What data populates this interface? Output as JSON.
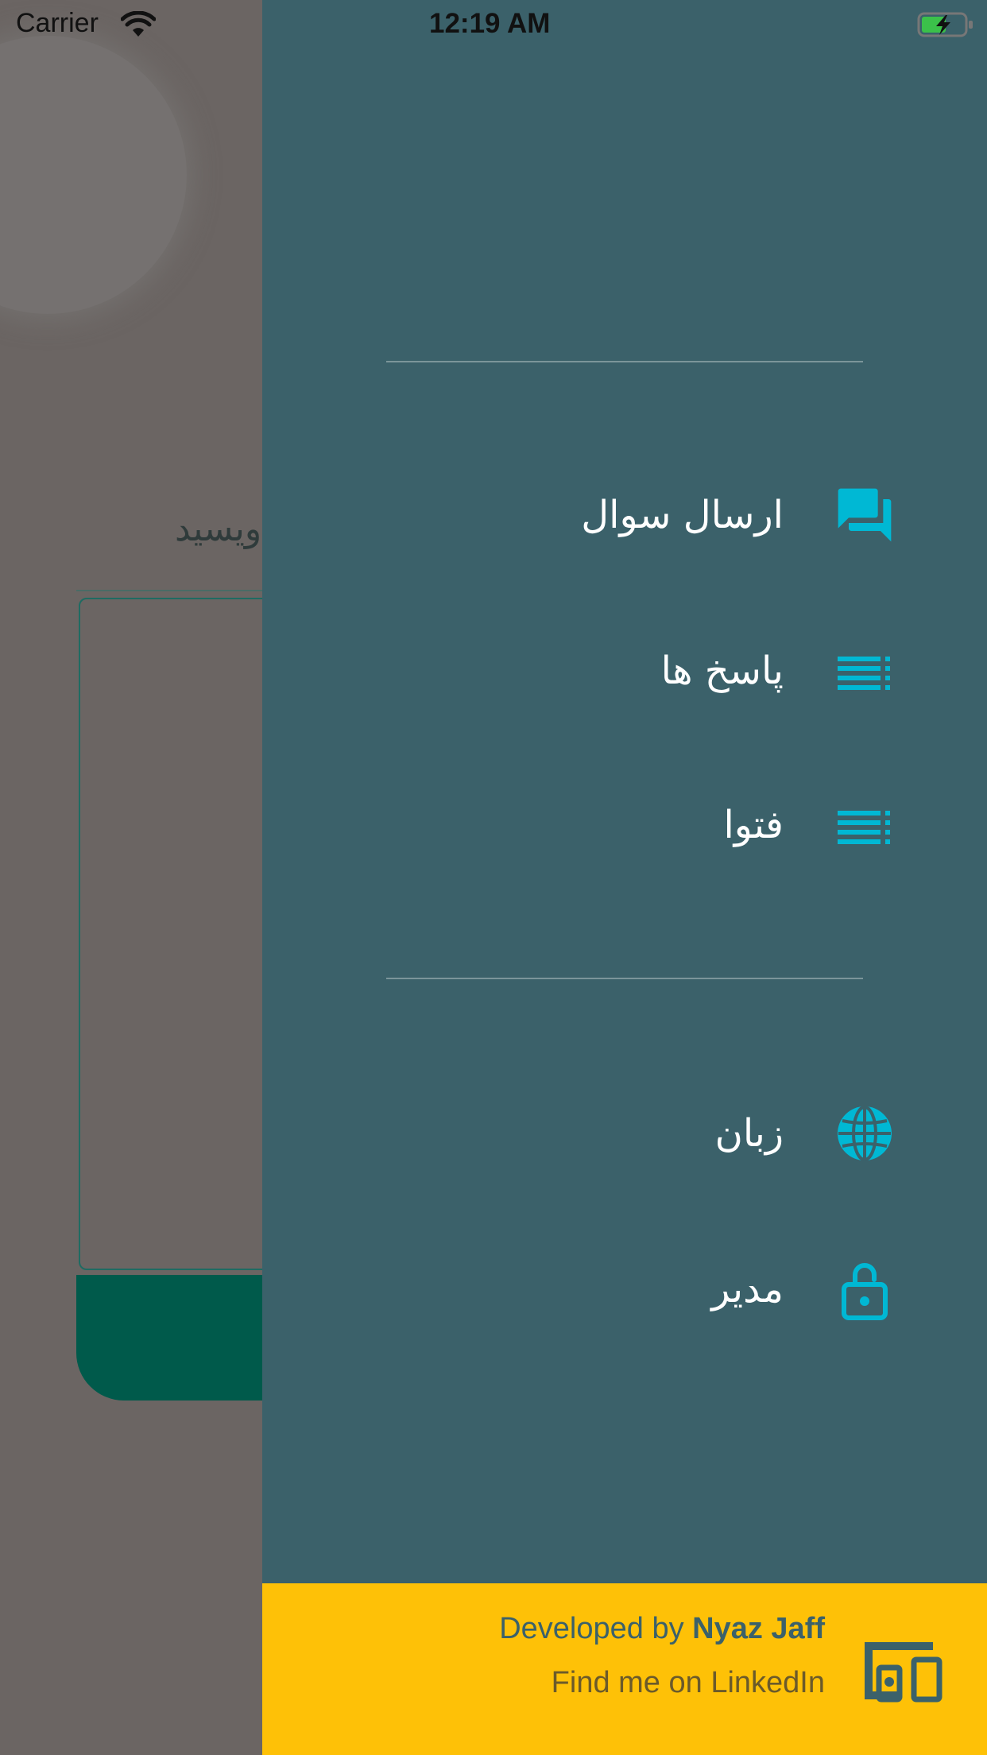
{
  "status_bar": {
    "carrier": "Carrier",
    "time": "12:19 AM",
    "icons": [
      "wifi-icon",
      "battery-charging-icon"
    ]
  },
  "background_page": {
    "prompt_text_partial": "ویسید"
  },
  "drawer": {
    "menu_primary": [
      {
        "label": "ارسال سوال",
        "icon": "forum-icon"
      },
      {
        "label": "پاسخ ها",
        "icon": "list-icon"
      },
      {
        "label": "فتوا",
        "icon": "list-icon"
      }
    ],
    "menu_secondary": [
      {
        "label": "زبان",
        "icon": "globe-icon"
      },
      {
        "label": "مدیر",
        "icon": "lock-open-icon"
      }
    ],
    "footer": {
      "developed_by_prefix": "Developed by",
      "developer_name": "Nyaz Jaff",
      "linkedin_text": "Find me on LinkedIn",
      "icon": "devices-icon"
    }
  },
  "colors": {
    "drawer_bg": "#3b616a",
    "icon_accent": "#00b8d4",
    "footer_bg": "#fec107",
    "overlay_bg": "#6b6563",
    "primary_button": "#005a4b"
  }
}
